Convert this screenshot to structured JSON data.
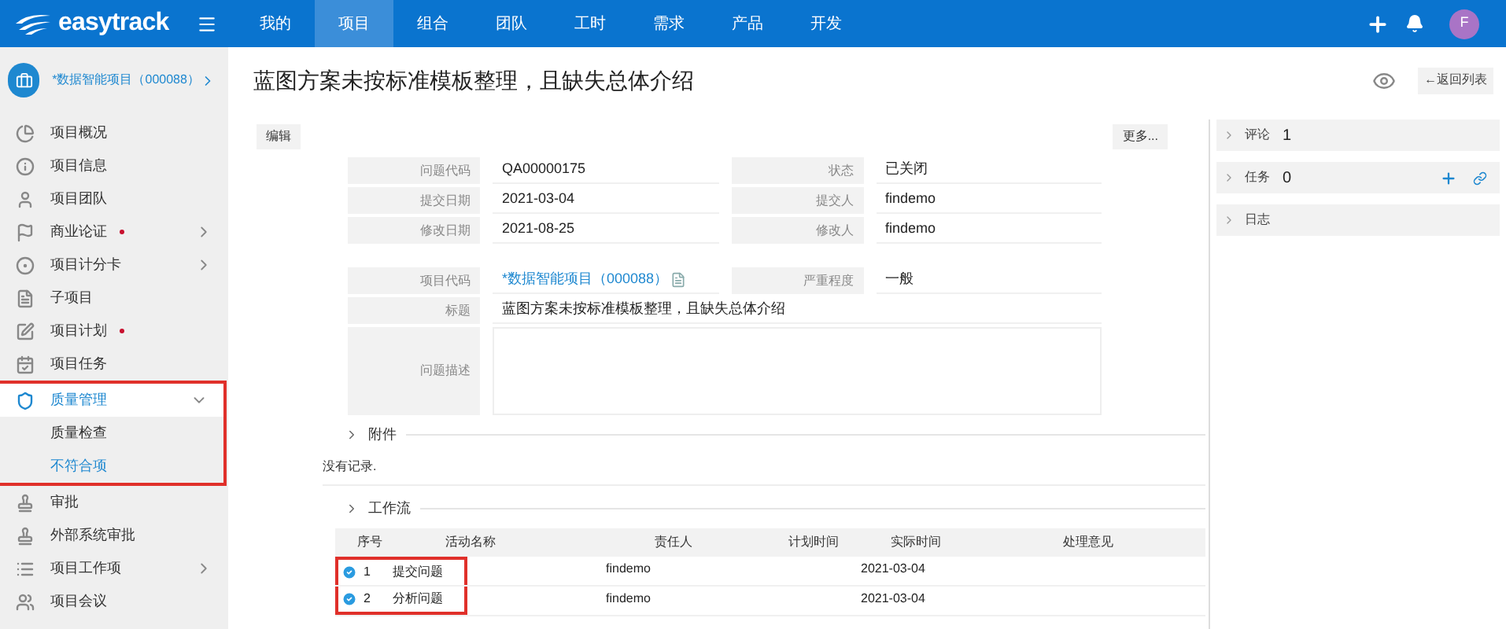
{
  "app": {
    "logo": "easytrack",
    "avatar_letter": "F"
  },
  "nav": [
    {
      "label": "我的",
      "selected": false
    },
    {
      "label": "项目",
      "selected": true
    },
    {
      "label": "组合",
      "selected": false
    },
    {
      "label": "团队",
      "selected": false
    },
    {
      "label": "工时",
      "selected": false
    },
    {
      "label": "需求",
      "selected": false
    },
    {
      "label": "产品",
      "selected": false
    },
    {
      "label": "开发",
      "selected": false
    }
  ],
  "project": {
    "name": "*数据智能项目（000088）"
  },
  "sidebar": {
    "items": [
      {
        "label": "项目概况",
        "dot": false,
        "has_submenu": false
      },
      {
        "label": "项目信息",
        "dot": false,
        "has_submenu": false
      },
      {
        "label": "项目团队",
        "dot": false,
        "has_submenu": false
      },
      {
        "label": "商业论证",
        "dot": true,
        "has_submenu": true
      },
      {
        "label": "项目计分卡",
        "dot": false,
        "has_submenu": true
      },
      {
        "label": "子项目",
        "dot": false,
        "has_submenu": false
      },
      {
        "label": "项目计划",
        "dot": true,
        "has_submenu": false
      },
      {
        "label": "项目任务",
        "dot": false,
        "has_submenu": false
      },
      {
        "label": "质量管理",
        "dot": false,
        "has_submenu": true,
        "expanded": true,
        "highlighted": true,
        "children": [
          {
            "label": "质量检查",
            "selected": false
          },
          {
            "label": "不符合项",
            "selected": true
          }
        ]
      },
      {
        "label": "审批",
        "dot": false,
        "has_submenu": false
      },
      {
        "label": "外部系统审批",
        "dot": false,
        "has_submenu": false
      },
      {
        "label": "项目工作项",
        "dot": false,
        "has_submenu": true
      },
      {
        "label": "项目会议",
        "dot": false,
        "has_submenu": false
      }
    ]
  },
  "page": {
    "title": "蓝图方案未按标准模板整理，且缺失总体介绍",
    "back_button": "←返回列表",
    "edit_button": "编辑",
    "more_button": "更多..."
  },
  "form": {
    "rows": [
      [
        {
          "label": "问题代码",
          "value": "QA00000175"
        },
        {
          "label": "状态",
          "value": "已关闭"
        }
      ],
      [
        {
          "label": "提交日期",
          "value": "2021-03-04"
        },
        {
          "label": "提交人",
          "value": "findemo"
        }
      ],
      [
        {
          "label": "修改日期",
          "value": "2021-08-25"
        },
        {
          "label": "修改人",
          "value": "findemo"
        }
      ]
    ],
    "project_code": {
      "label": "项目代码",
      "value": "*数据智能项目（000088）"
    },
    "severity": {
      "label": "严重程度",
      "value": "一般"
    },
    "title": {
      "label": "标题",
      "value": "蓝图方案未按标准模板整理，且缺失总体介绍"
    },
    "description": {
      "label": "问题描述"
    }
  },
  "attachments": {
    "heading": "附件",
    "empty_text": "没有记录."
  },
  "workflow": {
    "heading": "工作流",
    "columns": [
      "序号",
      "活动名称",
      "责任人",
      "计划时间",
      "实际时间",
      "处理意见"
    ],
    "rows": [
      {
        "seq": "1",
        "activity": "提交问题",
        "owner": "findemo",
        "actual": "2021-03-04",
        "done": true,
        "highlighted": true
      },
      {
        "seq": "2",
        "activity": "分析问题",
        "owner": "findemo",
        "actual": "2021-03-04",
        "done": true,
        "highlighted": true
      }
    ]
  },
  "side_panels": [
    {
      "label": "评论",
      "count": "1",
      "actions": false
    },
    {
      "label": "任务",
      "count": "0",
      "actions": true
    },
    {
      "label": "日志",
      "actions": false
    }
  ]
}
